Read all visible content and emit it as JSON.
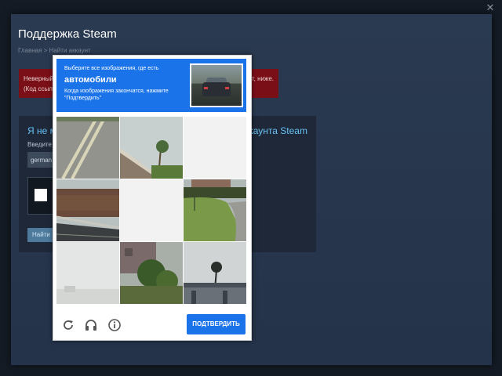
{
  "window": {
    "close_glyph": "✕"
  },
  "page": {
    "title": "Поддержка Steam",
    "breadcrumb_home": "Главная",
    "breadcrumb_sep": " > ",
    "breadcrumb_current": "Найти аккаунт"
  },
  "error": {
    "line1_left": "Неверный",
    "line1_right": "т, ниже.",
    "line2_left": "(Код ссыл"
  },
  "form": {
    "title_left": "Я не м",
    "title_right": "ккаунта Steam",
    "field_label": "Введите",
    "account_value": "german",
    "find_button": "Найти"
  },
  "captcha": {
    "instruction": "Выберите все изображения, где есть",
    "target": "автомобили",
    "hint_line1": "Когда изображения закончатся, нажмите",
    "hint_line2": "\"Подтвердить\"",
    "verify_label": "ПОДТВЕРДИТЬ",
    "accent_color": "#1a73e8",
    "icons": [
      "refresh-icon",
      "headphones-icon",
      "info-icon"
    ],
    "tiles": [
      "road-markings",
      "palm-tree-roof",
      "blank",
      "hedge-road",
      "blank",
      "house-lawn-road",
      "foggy-blank",
      "palm-house",
      "palm-bridge"
    ]
  }
}
